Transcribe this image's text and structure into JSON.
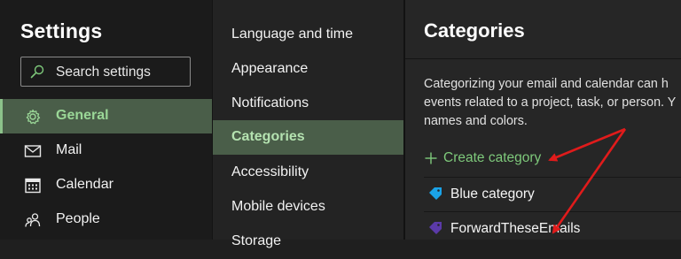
{
  "settings": {
    "title": "Settings",
    "search": {
      "placeholder": "Search settings",
      "icon": "search-icon"
    },
    "nav": [
      {
        "label": "General",
        "icon": "gear-icon",
        "selected": true
      },
      {
        "label": "Mail",
        "icon": "mail-icon",
        "selected": false
      },
      {
        "label": "Calendar",
        "icon": "calendar-icon",
        "selected": false
      },
      {
        "label": "People",
        "icon": "people-icon",
        "selected": false
      }
    ]
  },
  "general_menu": {
    "items": [
      {
        "label": "Language and time",
        "selected": false
      },
      {
        "label": "Appearance",
        "selected": false
      },
      {
        "label": "Notifications",
        "selected": false
      },
      {
        "label": "Categories",
        "selected": true
      },
      {
        "label": "Accessibility",
        "selected": false
      },
      {
        "label": "Mobile devices",
        "selected": false
      },
      {
        "label": "Storage",
        "selected": false
      }
    ]
  },
  "categories_panel": {
    "title": "Categories",
    "description_lines": [
      "Categorizing your email and calendar can h",
      "events related to a project, task, or person. Y",
      "names and colors."
    ],
    "create_label": "Create category",
    "categories": [
      {
        "label": "Blue category",
        "color": "#1aa3e8",
        "icon": "tag-icon"
      },
      {
        "label": "ForwardTheseEmails",
        "color": "#5b3aa8",
        "icon": "tag-icon"
      }
    ]
  },
  "colors": {
    "accent_green": "#7ec97b",
    "selected_bg": "#4a5e49",
    "annotation_arrow": "#e01b1b"
  }
}
